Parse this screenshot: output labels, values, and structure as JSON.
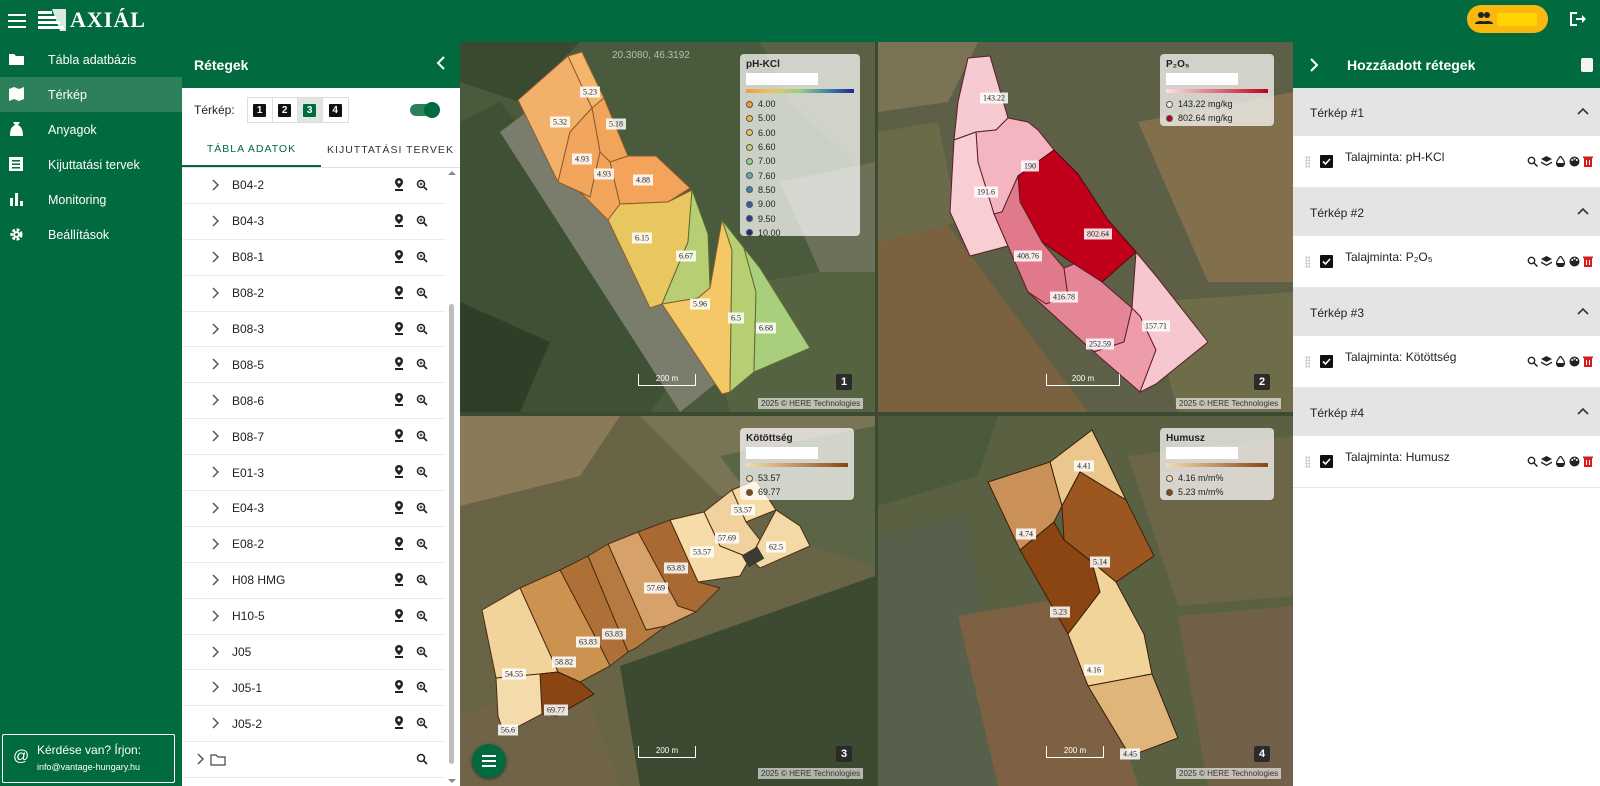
{
  "app": {
    "brand": "AXIÁL"
  },
  "nav": {
    "items": [
      {
        "label": "Tábla adatbázis"
      },
      {
        "label": "Térkép"
      },
      {
        "label": "Anyagok"
      },
      {
        "label": "Kijuttatási tervek"
      },
      {
        "label": "Monitoring"
      },
      {
        "label": "Beállítások"
      }
    ],
    "help_title": "Kérdése van? Írjon:",
    "help_email": "info@vantage-hungary.hu"
  },
  "layers": {
    "title": "Rétegek",
    "map_label": "Térkép:",
    "map_buttons": [
      "1",
      "2",
      "3",
      "4"
    ],
    "tabs": [
      "Tábla adatok",
      "Kijuttatási tervek"
    ],
    "plots": [
      "B04-2",
      "B04-3",
      "B08-1",
      "B08-2",
      "B08-3",
      "B08-5",
      "B08-6",
      "B08-7",
      "E01-3",
      "E04-3",
      "E08-2",
      "H08 HMG",
      "H10-5",
      "J05",
      "J05-1",
      "J05-2"
    ]
  },
  "maps": {
    "coord_readout": "20.3080, 46.3192",
    "scale_label": "200 m",
    "attribution": "2025 © HERE Technologies",
    "panels": [
      {
        "number": "1",
        "legend_title": "pH-KCl",
        "legend_items": [
          "4.00",
          "5.00",
          "6.00",
          "6.60",
          "7.00",
          "7.60",
          "8.50",
          "9.00",
          "9.50",
          "10.00"
        ],
        "legend_colors": [
          "#f29c3c",
          "#f0b550",
          "#e8c861",
          "#c6d16d",
          "#99cf80",
          "#5fb39a",
          "#3a87a8",
          "#315ea6",
          "#2b3d96",
          "#23278a"
        ],
        "zones": [
          "5.23",
          "5.32",
          "5.18",
          "4.93",
          "4.93",
          "4.88",
          "6.15",
          "6.67",
          "5.96",
          "6.5",
          "6.68"
        ]
      },
      {
        "number": "2",
        "legend_title": "P₂O₅",
        "legend_items": [
          "143.22 mg/kg",
          "802.64 mg/kg"
        ],
        "legend_colors": [
          "#fde0e5",
          "#c0001a"
        ],
        "zones": [
          "143.22",
          "190",
          "191.6",
          "802.64",
          "408.76",
          "416.78",
          "252.59",
          "157.71"
        ]
      },
      {
        "number": "3",
        "legend_title": "Kötöttség",
        "legend_items": [
          "53.57",
          "69.77"
        ],
        "legend_colors": [
          "#f4ddb0",
          "#8b4513"
        ],
        "zones": [
          "53.57",
          "57.69",
          "53.57",
          "62.5",
          "63.83",
          "57.69",
          "63.83",
          "63.83",
          "58.82",
          "54.55",
          "69.77",
          "56.6"
        ]
      },
      {
        "number": "4",
        "legend_title": "Humusz",
        "legend_items": [
          "4.16 m/m%",
          "5.23 m/m%"
        ],
        "legend_colors": [
          "#f4ddb0",
          "#8b4513"
        ],
        "zones": [
          "4.41",
          "4.74",
          "5.14",
          "5.23",
          "4.16",
          "4.45"
        ]
      }
    ]
  },
  "added": {
    "title": "Hozzáadott rétegek",
    "sections": [
      {
        "heading": "Térkép #1",
        "layer": "Talajminta: pH-KCl",
        "checked": true
      },
      {
        "heading": "Térkép #2",
        "layer": "Talajminta: P₂O₅",
        "checked": true
      },
      {
        "heading": "Térkép #3",
        "layer": "Talajminta: Kötöttség",
        "checked": true
      },
      {
        "heading": "Térkép #4",
        "layer": "Talajminta: Humusz",
        "checked": true
      }
    ]
  },
  "colors": {
    "brand_green": "#016a3f",
    "user_badge": "#f8b80f"
  }
}
